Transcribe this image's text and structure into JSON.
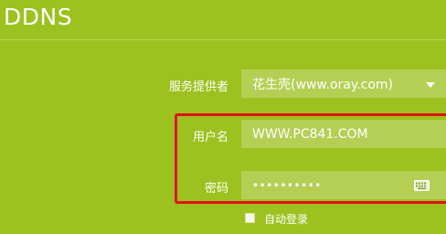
{
  "page": {
    "title": "DDNS"
  },
  "form": {
    "provider": {
      "label": "服务提供者",
      "value": "花生壳(www.oray.com)"
    },
    "username": {
      "label": "用户名",
      "value": "WWW.PC841.COM"
    },
    "password": {
      "label": "密码",
      "masked_value": "••••••••••"
    },
    "auto_login": {
      "label": "自动登录",
      "checked": false
    }
  },
  "icons": {
    "dropdown": "chevron-down-icon",
    "keyboard": "keyboard-icon"
  },
  "colors": {
    "background": "#9dc11f",
    "field": "#b5cf55",
    "highlight_border": "#e0121a"
  }
}
